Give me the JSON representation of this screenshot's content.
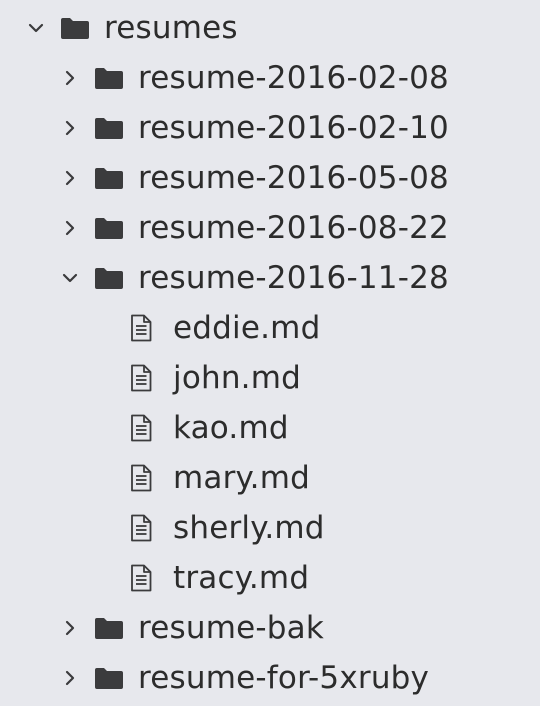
{
  "tree": {
    "root": {
      "label": "resumes",
      "expanded": true,
      "icon": "folder-icon"
    },
    "folders": [
      {
        "label": "resume-2016-02-08",
        "expanded": false
      },
      {
        "label": "resume-2016-02-10",
        "expanded": false
      },
      {
        "label": "resume-2016-05-08",
        "expanded": false
      },
      {
        "label": "resume-2016-08-22",
        "expanded": false
      },
      {
        "label": "resume-2016-11-28",
        "expanded": true
      }
    ],
    "files": [
      {
        "label": "eddie.md",
        "icon": "file-text-icon"
      },
      {
        "label": "john.md",
        "icon": "file-text-icon"
      },
      {
        "label": "kao.md",
        "icon": "file-text-icon"
      },
      {
        "label": "mary.md",
        "icon": "file-text-icon"
      },
      {
        "label": "sherly.md",
        "icon": "file-text-icon"
      },
      {
        "label": "tracy.md",
        "icon": "file-text-icon"
      }
    ],
    "folders_after": [
      {
        "label": "resume-bak",
        "expanded": false
      },
      {
        "label": "resume-for-5xruby",
        "expanded": false
      }
    ]
  },
  "colors": {
    "background": "#e7e8ed",
    "text": "#2c2c2c",
    "icon": "#3b3b3d"
  }
}
